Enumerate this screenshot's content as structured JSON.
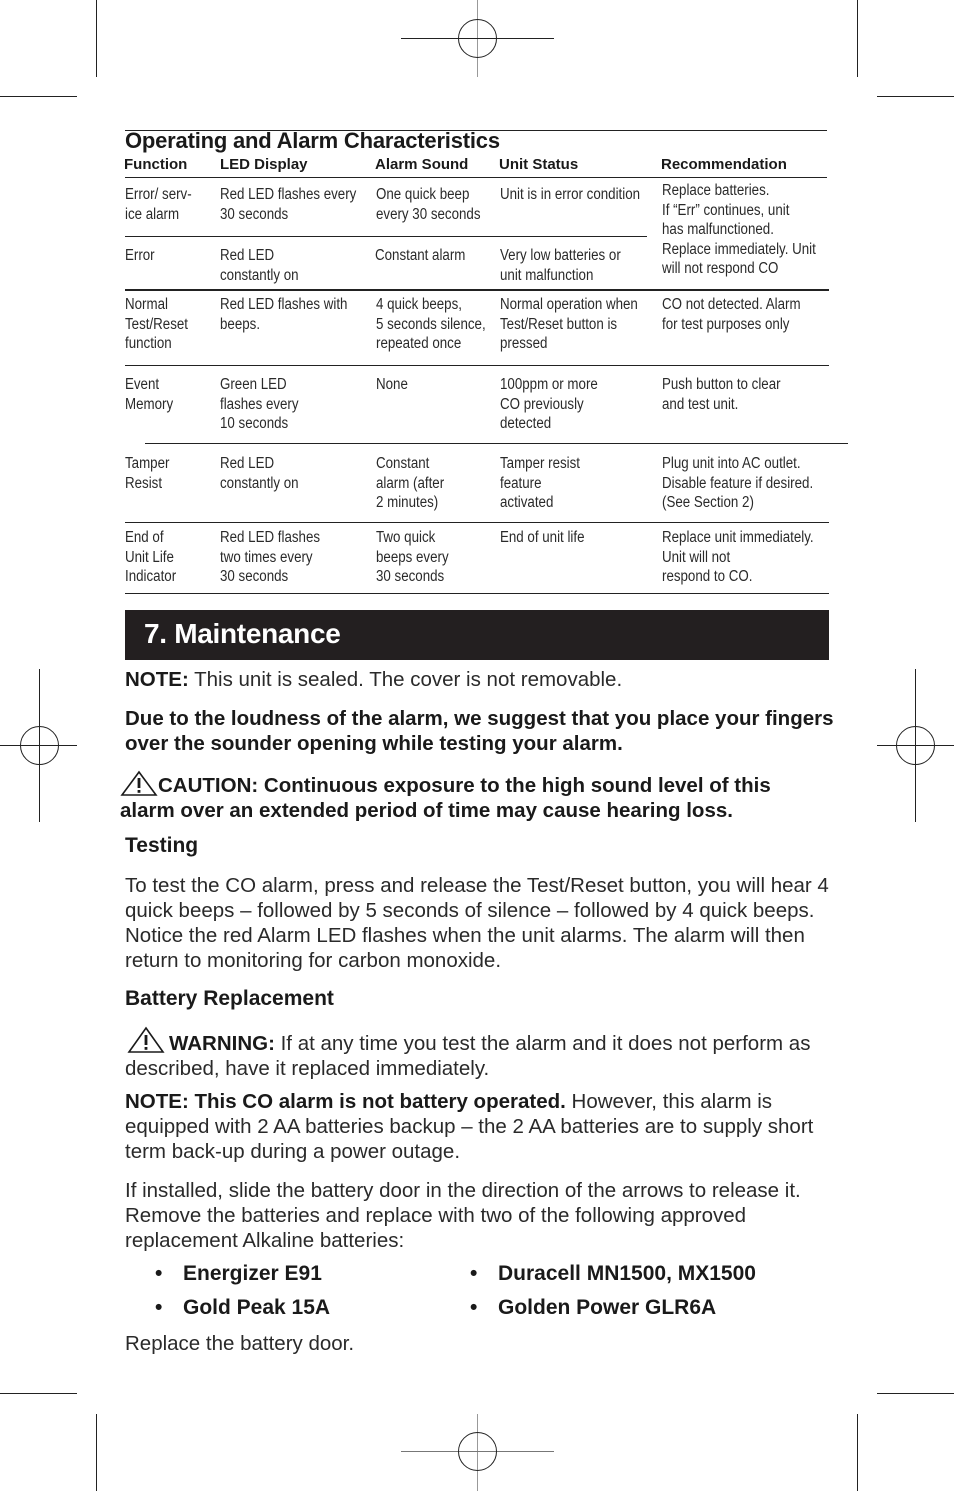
{
  "table": {
    "title": "Operating and Alarm Characteristics",
    "headers": [
      "Function",
      "LED Display",
      "Alarm Sound",
      "Unit Status",
      "Recommendation"
    ],
    "rows": [
      {
        "function": [
          "Error/ serv-",
          "ice alarm"
        ],
        "led": [
          "Red LED flashes every",
          "30 seconds"
        ],
        "sound": [
          "One quick beep",
          "every 30 seconds"
        ],
        "status": [
          "Unit is in error condition"
        ]
      },
      {
        "function": [
          "Error"
        ],
        "led": [
          "Red LED",
          "constantly on"
        ],
        "sound": [
          "Constant alarm"
        ],
        "status": [
          "Very low batteries or",
          "unit malfunction"
        ]
      },
      {
        "function": [
          "Normal",
          "Test/Reset",
          "function"
        ],
        "led": [
          "Red LED flashes with",
          "beeps."
        ],
        "sound": [
          "4 quick beeps,",
          "5 seconds silence,",
          "repeated once"
        ],
        "status": [
          "Normal operation when",
          "Test/Reset button is",
          "pressed"
        ],
        "recommendation": [
          "CO not detected. Alarm",
          "for test purposes only"
        ]
      },
      {
        "function": [
          "Event",
          "Memory"
        ],
        "led": [
          "Green LED",
          "flashes every",
          "10 seconds"
        ],
        "sound": [
          "None"
        ],
        "status": [
          "100ppm or more",
          "CO previously",
          "detected"
        ],
        "recommendation": [
          "Push button to clear",
          "and test unit."
        ]
      },
      {
        "function": [
          "Tamper",
          "Resist"
        ],
        "led": [
          "Red LED",
          "constantly on"
        ],
        "sound": [
          "Constant",
          "alarm (after",
          "2 minutes)"
        ],
        "status": [
          "Tamper resist",
          "feature",
          "activated"
        ],
        "recommendation": [
          "Plug unit into AC outlet.",
          "Disable feature if desired.",
          "(See Section 2)"
        ]
      },
      {
        "function": [
          "End of",
          "Unit Life",
          "Indicator"
        ],
        "led": [
          "Red LED flashes",
          "two times every",
          "30 seconds"
        ],
        "sound": [
          "Two quick",
          "beeps every",
          "30 seconds"
        ],
        "status": [
          "End of unit life"
        ],
        "recommendation": [
          "Replace unit immediately.",
          "Unit will not",
          "respond to CO."
        ]
      }
    ],
    "merged_recommendation": [
      "Replace batteries.",
      "If “Err” continues, unit",
      "has malfunctioned.",
      "Replace immediately. Unit",
      "will not respond CO"
    ]
  },
  "section": {
    "title": "7. Maintenance"
  },
  "note1": {
    "label": "NOTE:",
    "text": " This unit is sealed. The cover is not removable."
  },
  "loudness": "Due to the loudness of the alarm, we suggest that you place your fingers over the sounder opening while testing your alarm.",
  "caution": {
    "icon": "warning-triangle-icon",
    "text": "CAUTION: Continuous exposure to the high sound level of this alarm over an extended period of time may cause hearing loss."
  },
  "testing": {
    "heading": "Testing",
    "body": "To test the CO alarm, press and release the Test/Reset button, you will hear 4 quick beeps – followed by 5 seconds of silence – followed by 4 quick beeps. Notice the red Alarm LED flashes when the unit alarms. The alarm will then return to monitoring for carbon monoxide."
  },
  "battery": {
    "heading": "Battery Replacement",
    "warning_label": "WARNING:",
    "warning_text": " If at any time you test the alarm and it does not perform as described, have it replaced immediately.",
    "note_label": "NOTE: This CO alarm is not battery operated.",
    "note_text": " However, this alarm is equipped with 2 AA batteries backup – the 2 AA batteries are to supply short term back-up during a power outage.",
    "install_text": "If installed, slide the battery door in the direction of the arrows to release it. Remove the batteries and replace with two of the following approved replacement Alkaline batteries:",
    "batteries": [
      "Energizer E91",
      "Duracell MN1500, MX1500",
      "Gold Peak 15A",
      "Golden Power GLR6A"
    ],
    "bullet": "•",
    "closing": "Replace the battery door."
  }
}
